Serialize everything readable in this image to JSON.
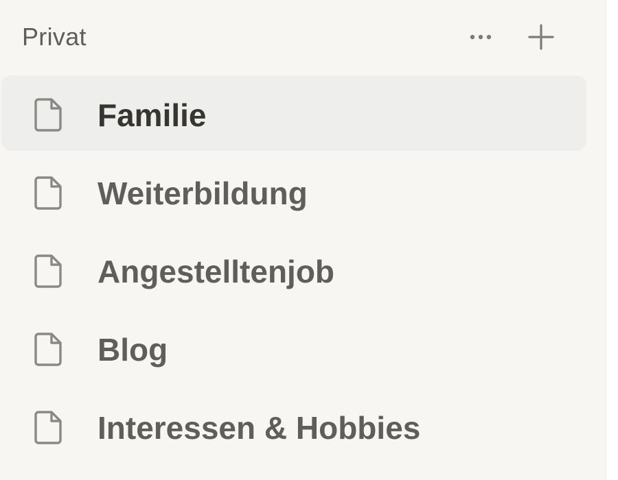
{
  "section": {
    "title": "Privat",
    "more_icon": "more-horizontal-icon",
    "add_icon": "plus-icon"
  },
  "pages": [
    {
      "label": "Familie",
      "icon": "page-icon",
      "selected": true
    },
    {
      "label": "Weiterbildung",
      "icon": "page-icon",
      "selected": false
    },
    {
      "label": "Angestelltenjob",
      "icon": "page-icon",
      "selected": false
    },
    {
      "label": "Blog",
      "icon": "page-icon",
      "selected": false
    },
    {
      "label": "Interessen & Hobbies",
      "icon": "page-icon",
      "selected": false
    }
  ],
  "colors": {
    "sidebar_background": "#f7f6f3",
    "selected_background": "#eeeeec",
    "text_primary": "#37352f",
    "text_secondary": "#5f5e5b",
    "icon": "#8a8984"
  }
}
